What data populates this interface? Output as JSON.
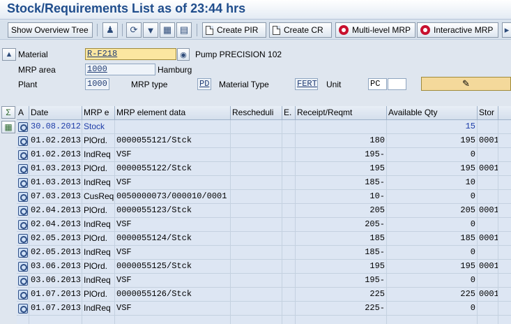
{
  "title": "Stock/Requirements List as of 23:44 hrs",
  "toolbar": {
    "show_overview_tree": "Show Overview Tree",
    "create_pir": "Create PIR",
    "create_cr": "Create CR",
    "multi_level_mrp": "Multi-level MRP",
    "interactive_mrp": "Interactive MRP",
    "icons": [
      "person-icon",
      "refresh-icon",
      "filter-icon",
      "pegging-icon",
      "layout-icon"
    ]
  },
  "header": {
    "material_label": "Material",
    "material_value": "R-F218",
    "material_desc": "Pump PRECISION 102",
    "mrp_area_label": "MRP area",
    "mrp_area_value": "1000",
    "mrp_area_desc": "Hamburg",
    "plant_label": "Plant",
    "plant_value": "1000",
    "mrp_type_label": "MRP type",
    "mrp_type_value": "PD",
    "material_type_label": "Material Type",
    "material_type_value": "FERT",
    "unit_label": "Unit",
    "unit_value": "PC",
    "unit_extra": ""
  },
  "grid": {
    "columns": [
      "A",
      "Date",
      "MRP e",
      "MRP element data",
      "Rescheduli",
      "E.",
      "Receipt/Reqmt",
      "Available Qty",
      "Stor"
    ],
    "rows": [
      {
        "date": "30.08.2012",
        "mrp_e": "Stock",
        "data": "",
        "resched": "",
        "e": "",
        "receipt": "",
        "avail": "15",
        "stor": "",
        "highlight": true
      },
      {
        "date": "01.02.2013",
        "mrp_e": "PlOrd.",
        "data": "0000055121/Stck",
        "resched": "",
        "e": "",
        "receipt": "180",
        "avail": "195",
        "stor": "0001"
      },
      {
        "date": "01.02.2013",
        "mrp_e": "IndReq",
        "data": "VSF",
        "resched": "",
        "e": "",
        "receipt": "195-",
        "avail": "0",
        "stor": ""
      },
      {
        "date": "01.03.2013",
        "mrp_e": "PlOrd.",
        "data": "0000055122/Stck",
        "resched": "",
        "e": "",
        "receipt": "195",
        "avail": "195",
        "stor": "0001"
      },
      {
        "date": "01.03.2013",
        "mrp_e": "IndReq",
        "data": "VSF",
        "resched": "",
        "e": "",
        "receipt": "185-",
        "avail": "10",
        "stor": ""
      },
      {
        "date": "07.03.2013",
        "mrp_e": "CusReq",
        "data": "0050000073/000010/0001",
        "resched": "",
        "e": "",
        "receipt": "10-",
        "avail": "0",
        "stor": ""
      },
      {
        "date": "02.04.2013",
        "mrp_e": "PlOrd.",
        "data": "0000055123/Stck",
        "resched": "",
        "e": "",
        "receipt": "205",
        "avail": "205",
        "stor": "0001"
      },
      {
        "date": "02.04.2013",
        "mrp_e": "IndReq",
        "data": "VSF",
        "resched": "",
        "e": "",
        "receipt": "205-",
        "avail": "0",
        "stor": ""
      },
      {
        "date": "02.05.2013",
        "mrp_e": "PlOrd.",
        "data": "0000055124/Stck",
        "resched": "",
        "e": "",
        "receipt": "185",
        "avail": "185",
        "stor": "0001"
      },
      {
        "date": "02.05.2013",
        "mrp_e": "IndReq",
        "data": "VSF",
        "resched": "",
        "e": "",
        "receipt": "185-",
        "avail": "0",
        "stor": ""
      },
      {
        "date": "03.06.2013",
        "mrp_e": "PlOrd.",
        "data": "0000055125/Stck",
        "resched": "",
        "e": "",
        "receipt": "195",
        "avail": "195",
        "stor": "0001"
      },
      {
        "date": "03.06.2013",
        "mrp_e": "IndReq",
        "data": "VSF",
        "resched": "",
        "e": "",
        "receipt": "195-",
        "avail": "0",
        "stor": ""
      },
      {
        "date": "01.07.2013",
        "mrp_e": "PlOrd.",
        "data": "0000055126/Stck",
        "resched": "",
        "e": "",
        "receipt": "225",
        "avail": "225",
        "stor": "0001"
      },
      {
        "date": "01.07.2013",
        "mrp_e": "IndReq",
        "data": "VSF",
        "resched": "",
        "e": "",
        "receipt": "225-",
        "avail": "0",
        "stor": ""
      }
    ]
  }
}
